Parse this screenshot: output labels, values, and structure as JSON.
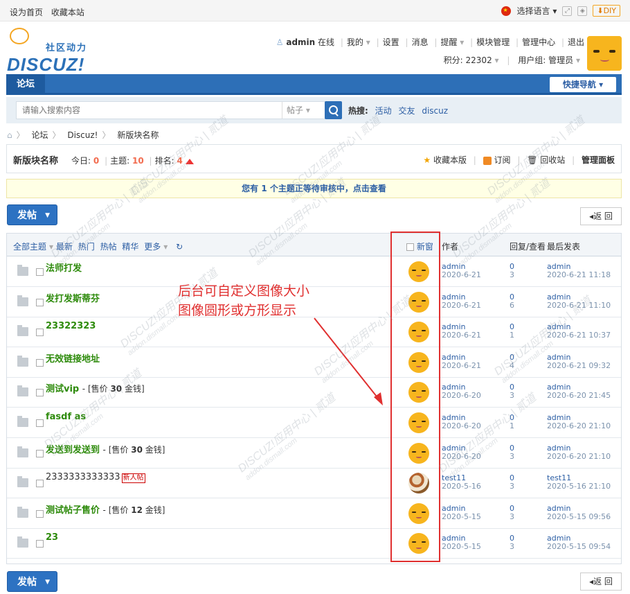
{
  "topbar": {
    "set_home": "设为首页",
    "favorite": "收藏本站",
    "language": "选择语言",
    "diy": "DIY"
  },
  "logo": {
    "tagline": "社区动力",
    "brand": "DISCUZ!"
  },
  "user": {
    "name": "admin",
    "status": "在线",
    "links": [
      "我的",
      "设置",
      "消息",
      "提醒",
      "模块管理",
      "管理中心",
      "退出"
    ],
    "points_label": "积分: 22302",
    "group_label": "用户组: 管理员"
  },
  "nav": {
    "tab": "论坛",
    "quick": "快捷导航 ▾"
  },
  "search": {
    "placeholder": "请输入搜索内容",
    "type": "帖子",
    "hot_label": "热搜:",
    "hot_terms": [
      "活动",
      "交友",
      "discuz"
    ]
  },
  "breadcrumb": [
    "论坛",
    "Discuz!",
    "新版块名称"
  ],
  "forum": {
    "name": "新版块名称",
    "today_label": "今日:",
    "today": "0",
    "topics_label": "主题:",
    "topics": "10",
    "rank_label": "排名:",
    "rank": "4",
    "favorite": "收藏本版",
    "subscribe": "订阅",
    "recycle": "回收站",
    "panel": "管理面板"
  },
  "notice": "您有 1 个主题正等待审核中，点击查看",
  "buttons": {
    "post": "发帖",
    "back": "◂返 回"
  },
  "table_header": {
    "filters": [
      "全部主题",
      "最新",
      "热门",
      "热帖",
      "精华",
      "更多"
    ],
    "refresh": "↻",
    "new_window": "新窗",
    "author": "作者",
    "reply_view": "回复/查看",
    "last_post": "最后发表"
  },
  "threads": [
    {
      "title": "法师打发",
      "price": "",
      "author": "admin",
      "date": "2020-6-21",
      "replies": "0",
      "views": "3",
      "last_user": "admin",
      "last_time": "2020-6-21 11:18",
      "avatar": "emoji"
    },
    {
      "title": "发打发斯蒂芬",
      "price": "",
      "author": "admin",
      "date": "2020-6-21",
      "replies": "0",
      "views": "6",
      "last_user": "admin",
      "last_time": "2020-6-21 11:10",
      "avatar": "emoji"
    },
    {
      "title": "23322323",
      "price": "",
      "author": "admin",
      "date": "2020-6-21",
      "replies": "0",
      "views": "1",
      "last_user": "admin",
      "last_time": "2020-6-21 10:37",
      "avatar": "emoji"
    },
    {
      "title": "无效链接地址",
      "price": "",
      "author": "admin",
      "date": "2020-6-21",
      "replies": "0",
      "views": "4",
      "last_user": "admin",
      "last_time": "2020-6-21 09:32",
      "avatar": "emoji"
    },
    {
      "title": "测试vip",
      "price": "30",
      "author": "admin",
      "date": "2020-6-20",
      "replies": "0",
      "views": "3",
      "last_user": "admin",
      "last_time": "2020-6-20 21:45",
      "avatar": "emoji"
    },
    {
      "title": "fasdf as",
      "price": "",
      "author": "admin",
      "date": "2020-6-20",
      "replies": "0",
      "views": "1",
      "last_user": "admin",
      "last_time": "2020-6-20 21:10",
      "avatar": "emoji"
    },
    {
      "title": "发送到发送到",
      "price": "30",
      "author": "admin",
      "date": "2020-6-20",
      "replies": "0",
      "views": "3",
      "last_user": "admin",
      "last_time": "2020-6-20 21:10",
      "avatar": "emoji"
    },
    {
      "title": "2333333333333",
      "price": "",
      "new_badge": "新人帖",
      "author": "test11",
      "date": "2020-5-16",
      "replies": "0",
      "views": "3",
      "last_user": "test11",
      "last_time": "2020-5-16 21:10",
      "avatar": "photo"
    },
    {
      "title": "测试帖子售价",
      "price": "12",
      "author": "admin",
      "date": "2020-5-15",
      "replies": "0",
      "views": "3",
      "last_user": "admin",
      "last_time": "2020-5-15 09:56",
      "avatar": "emoji"
    },
    {
      "title": "23",
      "price": "",
      "author": "admin",
      "date": "2020-5-15",
      "replies": "0",
      "views": "3",
      "last_user": "admin",
      "last_time": "2020-5-15 09:54",
      "avatar": "emoji"
    }
  ],
  "price_prefix": "[售价",
  "price_suffix": "金钱]",
  "annotation": [
    "后台可自定义图像大小",
    "图像圆形或方形显示"
  ],
  "watermark": {
    "line1": "DISCUZ!应用中心 | 贰道",
    "line2": "addon.dismall.com"
  },
  "colors": {
    "nav_blue": "#2d6fb7",
    "title_green": "#2e8b0c",
    "annotation_red": "#e03030"
  }
}
